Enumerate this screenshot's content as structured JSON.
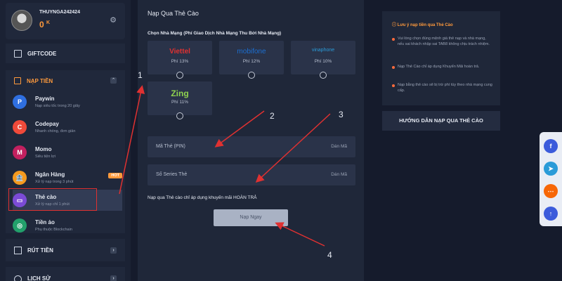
{
  "profile": {
    "username": "THUYNGA242424",
    "balance": "0",
    "balance_unit": "K"
  },
  "sidebar": {
    "giftcode": "GIFTCODE",
    "nap_tien": "NẠP TIỀN",
    "rut_tien": "RÚT TIỀN",
    "lich_su": "LỊCH SỬ",
    "items": [
      {
        "title": "Paywin",
        "sub": "Nạp siêu tốc trong 20 giây",
        "icon": "paywin-icon",
        "color": "#2f6fe0",
        "glyph": "P"
      },
      {
        "title": "Codepay",
        "sub": "Nhanh chóng, đơn giản",
        "icon": "codepay-icon",
        "color": "#f04a3a",
        "glyph": "C"
      },
      {
        "title": "Momo",
        "sub": "Siêu tiện lợi",
        "icon": "momo-icon",
        "color": "#c2205f",
        "glyph": "M"
      },
      {
        "title": "Ngân Hàng",
        "sub": "Xử lý nạp trong 3 phút",
        "icon": "bank-icon",
        "color": "#f59a1e",
        "glyph": "🏦",
        "badge": "HOT"
      },
      {
        "title": "Thẻ cào",
        "sub": "Xử lý nạp chỉ 1 phút",
        "icon": "card-icon",
        "color": "#7b4bd6",
        "glyph": "▭"
      },
      {
        "title": "Tiền ảo",
        "sub": "Phụ thuộc Blockchain",
        "icon": "crypto-icon",
        "color": "#22a06b",
        "glyph": "◎"
      }
    ]
  },
  "main": {
    "title": "Nạp Qua Thẻ Cào",
    "choose_label": "Chọn Nhà Mạng (Phí Giao Dịch Nhà Mạng Thu Bởi Nhà Mạng)",
    "carriers": [
      {
        "name": "Viettel",
        "fee": "Phí 13%",
        "color": "#e03131"
      },
      {
        "name": "mobifone",
        "fee": "Phí 12%",
        "color": "#1c6fd1"
      },
      {
        "name": "vinaphone",
        "fee": "Phí 10%",
        "color": "#2a9bd8"
      },
      {
        "name": "Zing",
        "fee": "Phí 11%",
        "color": "#8fd14f"
      }
    ],
    "pin_label": "Mã Thẻ (PIN)",
    "serial_label": "Số Series Thẻ",
    "paste_label": "Dán Mã",
    "note": "Nạp qua Thẻ cào chỉ áp dụng khuyến mãi HOÀN TRẢ",
    "submit": "Nạp Ngay"
  },
  "info": {
    "title": "Lưu ý nạp tiền qua Thẻ Cào",
    "bullets": [
      "Vui lòng chọn đúng mệnh giá thẻ nạp và nhà mạng, nếu sai khách nhập sai TAB8 không chịu trách nhiệm.",
      "Nạp Thẻ Cào chỉ áp dụng Khuyến Mãi hoàn trả.",
      "Nạp bằng thẻ cào sẽ bị trừ phí tùy theo nhà mạng cung cấp."
    ],
    "guide": "HƯỚNG DẪN NẠP QUA THẺ CÀO"
  },
  "annotations": [
    "1",
    "2",
    "3",
    "4"
  ]
}
